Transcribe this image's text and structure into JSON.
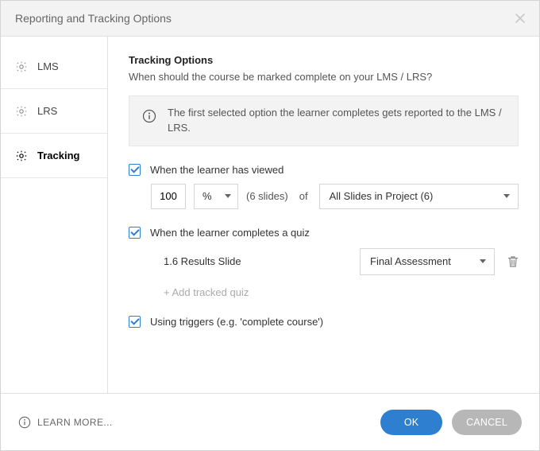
{
  "window": {
    "title": "Reporting and Tracking Options"
  },
  "sidebar": {
    "items": [
      {
        "label": "LMS"
      },
      {
        "label": "LRS"
      },
      {
        "label": "Tracking"
      }
    ]
  },
  "main": {
    "section_title": "Tracking Options",
    "section_subtitle": "When should the course be marked complete on your LMS / LRS?",
    "info_text": "The first selected option the learner completes gets reported to the LMS / LRS.",
    "opt_viewed": {
      "label": "When the learner has viewed",
      "value": "100",
      "unit": "%",
      "count_text": "(6 slides)",
      "of_text": "of",
      "range": "All Slides in Project (6)"
    },
    "opt_quiz": {
      "label": "When the learner completes a quiz",
      "row": {
        "name": "1.6 Results Slide",
        "result": "Final Assessment"
      },
      "add_text": "+ Add tracked quiz"
    },
    "opt_triggers": {
      "label": "Using triggers (e.g. 'complete course')"
    }
  },
  "footer": {
    "learn_more": "LEARN MORE...",
    "ok": "OK",
    "cancel": "CANCEL"
  }
}
